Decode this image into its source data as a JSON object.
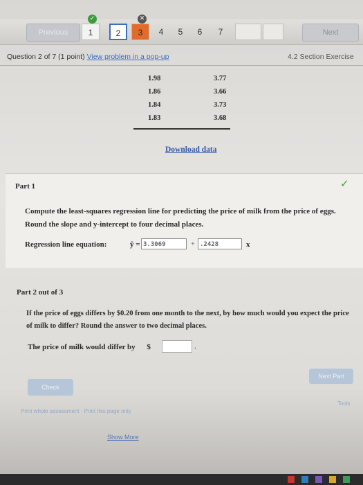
{
  "nav": {
    "prev_label": "Previous",
    "question_numbers": [
      "1",
      "2",
      "3",
      "4",
      "5",
      "6",
      "7"
    ],
    "next_label": "Next"
  },
  "header": {
    "question_label": "Question 2 of 7",
    "points": "(1 point)",
    "popup_link": "View problem in a pop-up",
    "section": "4.2 Section Exercise"
  },
  "table": {
    "rows": [
      [
        "1.98",
        "3.77"
      ],
      [
        "1.86",
        "3.66"
      ],
      [
        "1.84",
        "3.73"
      ],
      [
        "1.83",
        "3.68"
      ]
    ]
  },
  "download_link": "Download data",
  "part1": {
    "title": "Part 1",
    "instructions": "Compute the least-squares regression line for predicting the price of milk from the price of eggs. Round the slope and y-intercept to four decimal places.",
    "equation_label": "Regression line equation:",
    "yhat": "ŷ =",
    "intercept_value": "3.3069",
    "plus": "+",
    "slope_value": ".2428",
    "x_var": "x"
  },
  "part2": {
    "title": "Part 2 out of 3",
    "question": "If the price of eggs differs by $0.20 from one month to the next, by how much would you expect the price of milk to differ? Round the answer to two decimal places.",
    "answer_label": "The price of milk would differ by",
    "currency": "$",
    "answer_value": "",
    "trailing": "."
  },
  "buttons": {
    "check_label": "Check",
    "next_part_label": "Next Part"
  },
  "links": {
    "faint_bottom": "Print whole assessment · Print this page only",
    "tools": "Tools",
    "show_more": "Show More"
  }
}
